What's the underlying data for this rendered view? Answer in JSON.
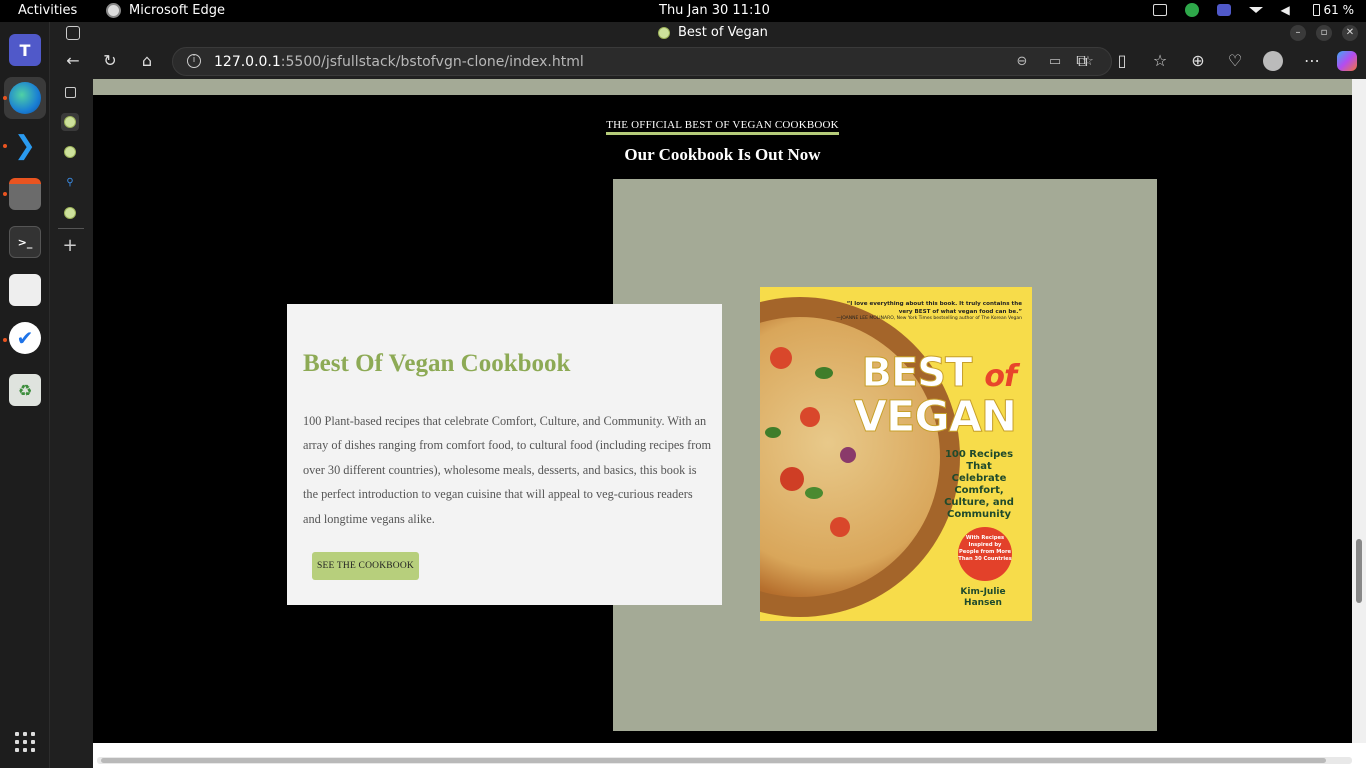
{
  "system": {
    "activities": "Activities",
    "app_name": "Microsoft Edge",
    "clock": "Thu Jan 30  11:10",
    "battery": "61 %"
  },
  "browser": {
    "tab_title": "Best of Vegan",
    "url_host": "127.0.0.1",
    "url_rest": ":5500/jsfullstack/bstofvgn-clone/index.html"
  },
  "page": {
    "eyebrow": "THE OFFICIAL BEST OF VEGAN COOKBOOK",
    "headline": "Our Cookbook Is Out Now",
    "card_title": "Best Of Vegan Cookbook",
    "card_body": "100 Plant-based recipes that celebrate Comfort, Culture, and Community. With an array of dishes ranging from comfort food, to cultural food (including recipes from over 30 different countries), wholesome meals, desserts, and basics, this book is the perfect introduction to vegan cuisine that will appeal to veg-curious readers and longtime vegans alike.",
    "cta_label": "SEE THE COOKBOOK"
  },
  "book_cover": {
    "quote": "“I love everything about this book. It truly contains the very BEST of what vegan food can be.”",
    "quote_attribution": "—JOANNE LEE MOLINARO, New York Times bestselling author of The Korean Vegan",
    "title_best": "BEST",
    "title_of": "of",
    "title_vegan": "VEGAN",
    "subtitle": "100 Recipes That Celebrate Comfort, Culture, and Community",
    "badge": "With Recipes Inspired by People from More Than 30 Countries",
    "author": "Kim-Julie Hansen"
  },
  "colors": {
    "accent_green": "#8daa55",
    "button_green": "#b7cf7c",
    "panel_sage": "#a4aa96"
  },
  "icons": {
    "toolbar": [
      "back-icon",
      "refresh-icon",
      "home-icon",
      "zoom-out-icon",
      "immersive-reader-icon",
      "favorite-star-icon",
      "extensions-icon",
      "split-screen-icon",
      "favorites-icon",
      "collections-icon",
      "browser-essentials-icon",
      "profile-icon",
      "more-icon",
      "copilot-icon"
    ]
  }
}
